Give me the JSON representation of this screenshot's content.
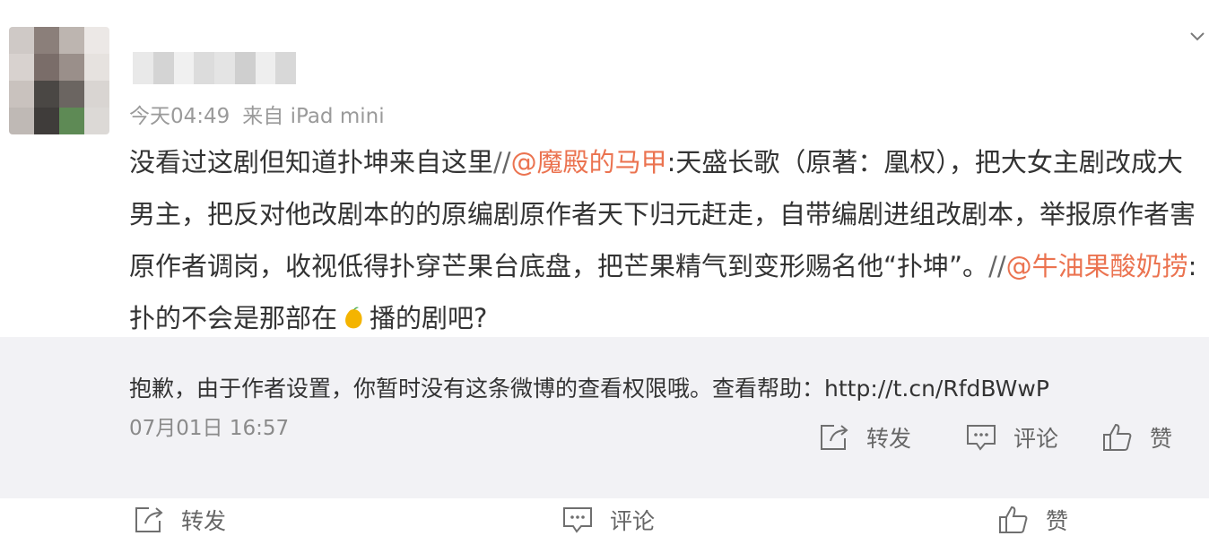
{
  "post": {
    "meta": {
      "time": "今天04:49",
      "source": "来自 iPad mini"
    },
    "content": {
      "text1": "没看过这剧但知道扑坤来自这里",
      "slash1": "//",
      "mention1": "@魔殿的马甲",
      "text2": ":天盛长歌（原著：凰权），把大女主剧改成大男主，把反对他改剧本的的原编剧原作者天下归元赶走，自带编剧进组改剧本，举报原作者害原作者调岗，收视低得扑穿芒果台底盘，把芒果精气到变形赐名他“扑坤”。",
      "slash2": "//",
      "mention2": "@牛油果酸奶捞",
      "text3": ":扑的不会是那部在",
      "text4": "播的剧吧?",
      "emoji": "mango-emoji"
    }
  },
  "repost": {
    "notice": "抱歉，由于作者设置，你暂时没有这条微博的查看权限哦。查看帮助：http://t.cn/RfdBWwP",
    "time": "07月01日 16:57",
    "actions": {
      "forward": "转发",
      "comment": "评论",
      "like": "赞"
    }
  },
  "bottom_actions": {
    "forward": "转发",
    "comment": "评论",
    "like": "赞"
  },
  "colors": {
    "mention": "#eb7350",
    "meta_text": "#9a9a9a",
    "repost_background": "#f2f2f5"
  }
}
